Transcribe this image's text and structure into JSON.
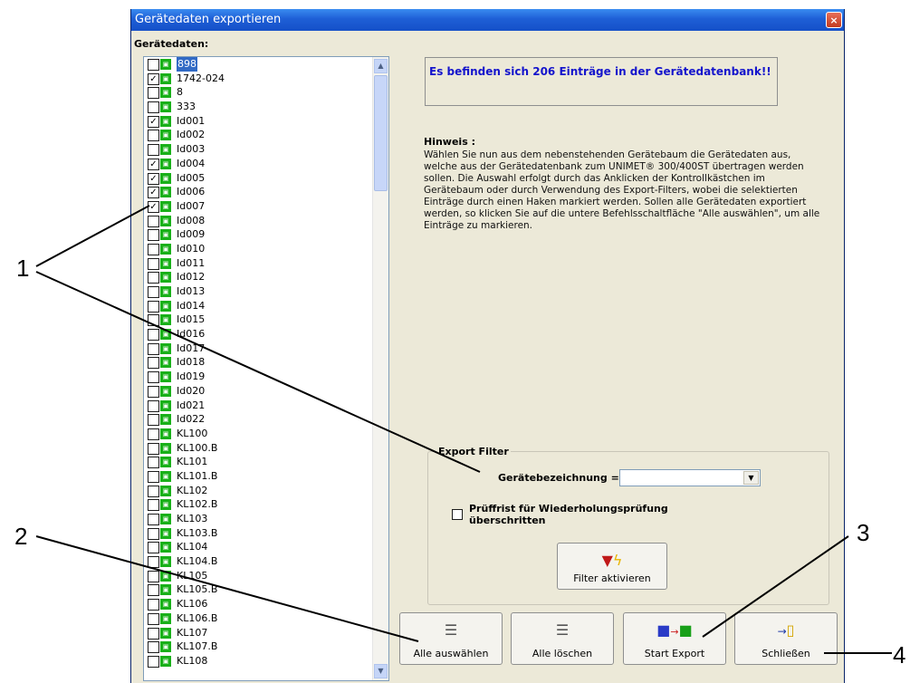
{
  "window": {
    "title": "Gerätedaten exportieren",
    "close_glyph": "×"
  },
  "tree": {
    "label": "Gerätedaten:",
    "items": [
      {
        "label": "898",
        "checked": false,
        "selected": true
      },
      {
        "label": "1742-024",
        "checked": true
      },
      {
        "label": "8",
        "checked": false
      },
      {
        "label": "333",
        "checked": false
      },
      {
        "label": "Id001",
        "checked": true
      },
      {
        "label": "Id002",
        "checked": false
      },
      {
        "label": "Id003",
        "checked": false
      },
      {
        "label": "Id004",
        "checked": true
      },
      {
        "label": "Id005",
        "checked": true
      },
      {
        "label": "Id006",
        "checked": true
      },
      {
        "label": "Id007",
        "checked": true
      },
      {
        "label": "Id008",
        "checked": false
      },
      {
        "label": "Id009",
        "checked": false
      },
      {
        "label": "Id010",
        "checked": false
      },
      {
        "label": "Id011",
        "checked": false
      },
      {
        "label": "Id012",
        "checked": false
      },
      {
        "label": "Id013",
        "checked": false
      },
      {
        "label": "Id014",
        "checked": false
      },
      {
        "label": "Id015",
        "checked": false
      },
      {
        "label": "Id016",
        "checked": false
      },
      {
        "label": "Id017",
        "checked": false
      },
      {
        "label": "Id018",
        "checked": false
      },
      {
        "label": "Id019",
        "checked": false
      },
      {
        "label": "Id020",
        "checked": false
      },
      {
        "label": "Id021",
        "checked": false
      },
      {
        "label": "Id022",
        "checked": false
      },
      {
        "label": "KL100",
        "checked": false
      },
      {
        "label": "KL100.B",
        "checked": false
      },
      {
        "label": "KL101",
        "checked": false
      },
      {
        "label": "KL101.B",
        "checked": false
      },
      {
        "label": "KL102",
        "checked": false
      },
      {
        "label": "KL102.B",
        "checked": false
      },
      {
        "label": "KL103",
        "checked": false
      },
      {
        "label": "KL103.B",
        "checked": false
      },
      {
        "label": "KL104",
        "checked": false
      },
      {
        "label": "KL104.B",
        "checked": false
      },
      {
        "label": "KL105",
        "checked": false
      },
      {
        "label": "KL105.B",
        "checked": false
      },
      {
        "label": "KL106",
        "checked": false
      },
      {
        "label": "KL106.B",
        "checked": false
      },
      {
        "label": "KL107",
        "checked": false
      },
      {
        "label": "KL107.B",
        "checked": false
      },
      {
        "label": "KL108",
        "checked": false
      }
    ]
  },
  "info": {
    "message": "Es befinden sich 206 Einträge in der Gerätedatenbank!!"
  },
  "hint": {
    "title": "Hinweis :",
    "text": "Wählen Sie nun aus dem nebenstehenden Gerätebaum die Gerätedaten aus, welche aus der Gerätedatenbank zum UNIMET® 300/400ST übertragen werden sollen. Die Auswahl erfolgt durch das Anklicken der Kontrollkästchen im Gerätebaum oder durch Verwendung des Export-Filters, wobei die selektierten Einträge durch einen Haken markiert werden. Sollen alle Gerätedaten exportiert werden, so klicken Sie auf die untere Befehlsschaltfläche \"Alle auswählen\", um alle Einträge zu markieren."
  },
  "filter": {
    "group_title": "Export Filter",
    "device_label": "Gerätebezeichnung =",
    "device_value": "",
    "deadline_label_1": "Prüffrist für Wiederholungsprüfung",
    "deadline_label_2": "überschritten",
    "activate_label": "Filter aktivieren"
  },
  "buttons": {
    "select_all": "Alle auswählen",
    "clear_all": "Alle löschen",
    "start_export": "Start Export",
    "close": "Schließen"
  },
  "annotations": [
    "1",
    "2",
    "3",
    "4"
  ],
  "colors": {
    "title_bar": "#1e5fd6",
    "info_text": "#1414cc",
    "device_icon": "#19b019",
    "selection": "#316ac5"
  }
}
